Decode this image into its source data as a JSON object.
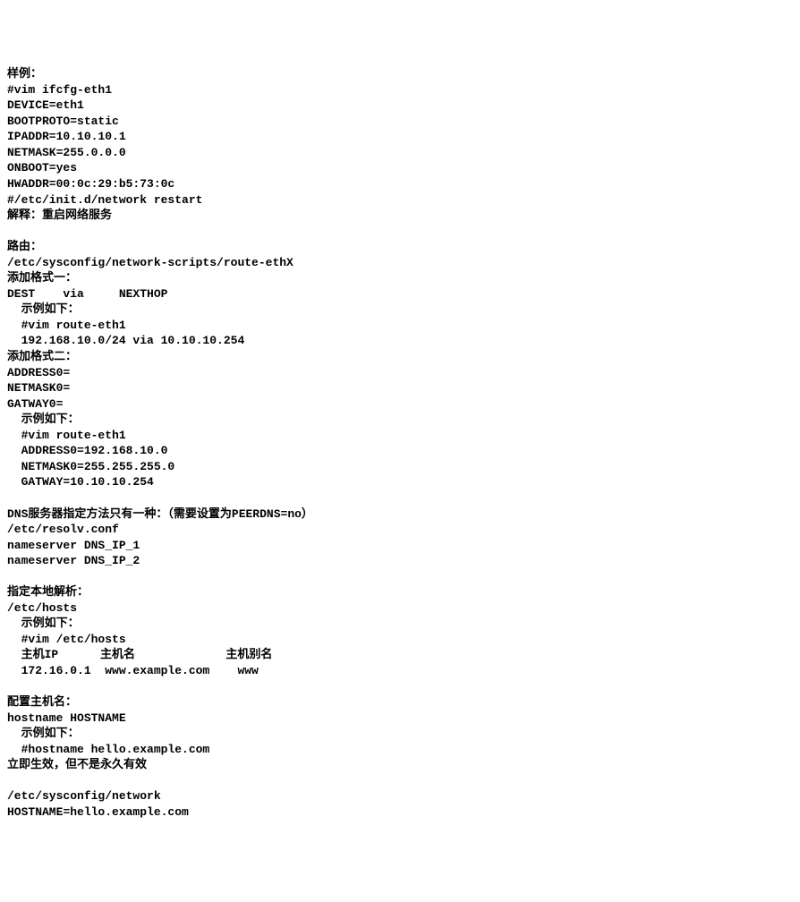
{
  "lines": [
    "样例：",
    "#vim ifcfg-eth1",
    "DEVICE=eth1",
    "BOOTPROTO=static",
    "IPADDR=10.10.10.1",
    "NETMASK=255.0.0.0",
    "ONBOOT=yes",
    "HWADDR=00:0c:29:b5:73:0c",
    "#/etc/init.d/network restart",
    "解释：重启网络服务",
    "",
    "路由：",
    "/etc/sysconfig/network-scripts/route-ethX",
    "添加格式一：",
    "DEST    via     NEXTHOP",
    "  示例如下：",
    "  #vim route-eth1",
    "  192.168.10.0/24 via 10.10.10.254",
    "添加格式二：",
    "ADDRESS0=",
    "NETMASK0=",
    "GATWAY0=",
    "  示例如下：",
    "  #vim route-eth1",
    "  ADDRESS0=192.168.10.0",
    "  NETMASK0=255.255.255.0",
    "  GATWAY=10.10.10.254",
    "",
    "DNS服务器指定方法只有一种：（需要设置为PEERDNS=no）",
    "/etc/resolv.conf",
    "nameserver DNS_IP_1",
    "nameserver DNS_IP_2",
    "",
    "指定本地解析：",
    "/etc/hosts",
    "  示例如下：",
    "  #vim /etc/hosts",
    "  主机IP      主机名             主机别名",
    "  172.16.0.1  www.example.com    www",
    "",
    "配置主机名：",
    "hostname HOSTNAME",
    "  示例如下：",
    "  #hostname hello.example.com",
    "立即生效，但不是永久有效",
    "",
    "/etc/sysconfig/network",
    "HOSTNAME=hello.example.com"
  ]
}
